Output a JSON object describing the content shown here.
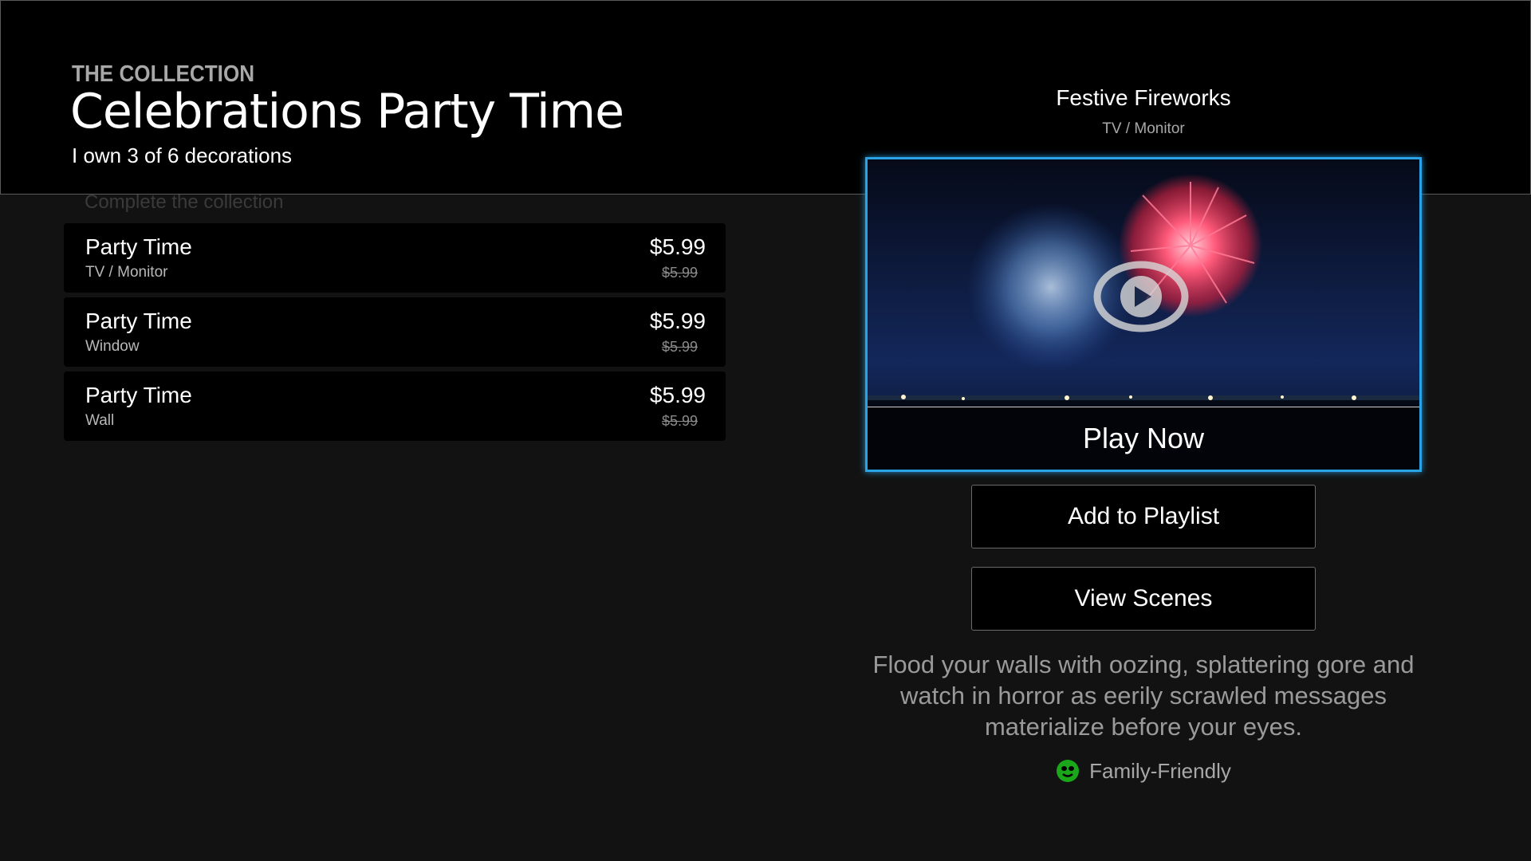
{
  "header": {
    "eyebrow": "THE COLLECTION",
    "title": "Celebrations Party Time",
    "ownership": "I own 3 of 6 decorations",
    "faded_label": "Complete the collection"
  },
  "items": [
    {
      "name": "Party Time",
      "display": "TV / Monitor",
      "price": "$5.99",
      "original_price": "$5.99"
    },
    {
      "name": "Party Time",
      "display": "Window",
      "price": "$5.99",
      "original_price": "$5.99"
    },
    {
      "name": "Party Time",
      "display": "Wall",
      "price": "$5.99",
      "original_price": "$5.99"
    }
  ],
  "preview": {
    "title": "Festive Fireworks",
    "display": "TV / Monitor",
    "play_label": "Play Now",
    "thumbnail_icon": "play-icon"
  },
  "actions": {
    "add_to_playlist": "Add to Playlist",
    "view_scenes": "View Scenes"
  },
  "description": "Flood your walls with oozing, splattering gore and watch in horror as eerily scrawled messages materialize before your eyes.",
  "rating": {
    "label": "Family-Friendly",
    "icon": "smiley-face-icon",
    "color": "#1aa81a"
  },
  "colors": {
    "focus": "#29a3e6",
    "background": "#121212",
    "panel": "#000000"
  }
}
